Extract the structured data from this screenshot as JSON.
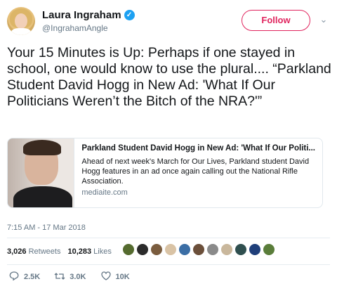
{
  "author": {
    "name": "Laura Ingraham",
    "handle": "@IngrahamAngle",
    "verified_icon": "verified-badge"
  },
  "follow_label": "Follow",
  "tweet_text": "Your 15 Minutes is Up: Perhaps if one stayed in school, one would know to use the plural.... “Parkland Student David Hogg in New Ad: 'What If Our Politicians Weren’t the Bitch of the NRA?'”",
  "card": {
    "title": "Parkland Student David Hogg in New Ad: 'What If Our Politi...",
    "description": "Ahead of next week's March for Our Lives, Parkland student David Hogg features in an ad once again calling out the National Rifle Association.",
    "domain": "mediaite.com"
  },
  "timestamp": "7:15 AM - 17 Mar 2018",
  "stats": {
    "retweets_count": "3,026",
    "retweets_label": "Retweets",
    "likes_count": "10,283",
    "likes_label": "Likes"
  },
  "liker_colors": [
    "#556b2f",
    "#2b2b2b",
    "#7a5c3e",
    "#d9c3a5",
    "#3b6ea5",
    "#6b4f3a",
    "#8a8a8a",
    "#c9b79c",
    "#2f4f4f",
    "#1f3f7a",
    "#5a7d3a"
  ],
  "actions": {
    "reply_count": "2.5K",
    "retweet_count": "3.0K",
    "like_count": "10K"
  },
  "colors": {
    "accent": "#e0245e",
    "verified": "#1da1f2",
    "muted": "#657786"
  }
}
